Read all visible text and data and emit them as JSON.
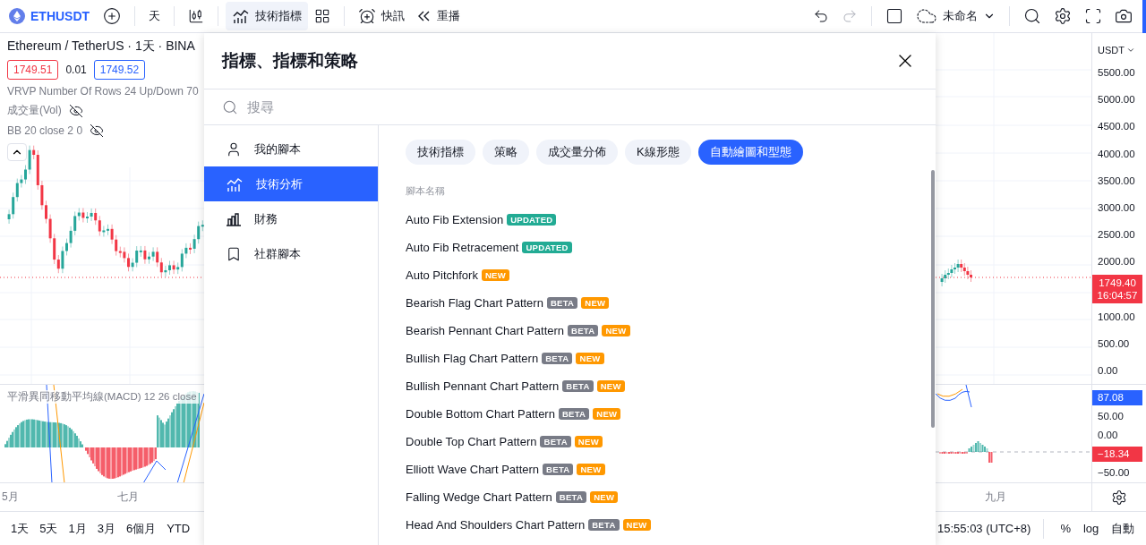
{
  "toolbar": {
    "symbol": "ETHUSDT",
    "interval": "天",
    "indicators_button": {
      "label": "技術指標",
      "selected": true
    },
    "alerts": "快訊",
    "replay": "重播",
    "layout_name": "未命名",
    "redo_disabled": true
  },
  "legend": {
    "title": "Ethereum / TetherUS · 1天 · BINA",
    "bid": "1749.51",
    "spread": "0.01",
    "ask": "1749.52",
    "indicators": [
      {
        "label": "VRVP Number Of Rows 24 Up/Down 70",
        "hidden": false
      },
      {
        "label": "成交量(Vol)",
        "hidden": true
      },
      {
        "label": "BB 20 close 2 0",
        "hidden": true
      }
    ],
    "macd": "平滑異同移動平均線(MACD) 12 26 close"
  },
  "price_axis": {
    "currency": "USDT",
    "ticks_upper": [
      "5500.00",
      "5000.00",
      "4500.00",
      "4000.00",
      "3500.00",
      "3000.00",
      "2500.00",
      "2000.00"
    ],
    "ticks_lower": [
      "1000.00",
      "500.00",
      "0.00"
    ],
    "price_tag": {
      "price": "1749.40",
      "countdown": "16:04:57",
      "color": "#f23645"
    }
  },
  "macd_axis": {
    "tags": [
      {
        "value": "87.08",
        "color": "#2962ff"
      },
      {
        "value": "50.00"
      },
      {
        "value": "0.00"
      },
      {
        "value": "−18.34",
        "color": "#f23645"
      },
      {
        "value": "−50.00"
      }
    ]
  },
  "time_axis": {
    "left": [
      "5月",
      "七月"
    ],
    "right": [
      "九月"
    ]
  },
  "bottom_bar": {
    "ranges": [
      "1天",
      "5天",
      "1月",
      "3月",
      "6個月",
      "YTD"
    ],
    "clock": "15:55:03 (UTC+8)",
    "percent": "%",
    "log": "log",
    "auto": "自動"
  },
  "dialog": {
    "title": "指標、指標和策略",
    "search_placeholder": "搜尋",
    "nav": [
      {
        "label": "我的腳本",
        "kind": "person",
        "selected": false
      },
      {
        "label": "技術分析",
        "kind": "analysis",
        "selected": true
      },
      {
        "label": "財務",
        "kind": "finance",
        "selected": false
      },
      {
        "label": "社群腳本",
        "kind": "bookmark",
        "selected": false
      }
    ],
    "chips": [
      {
        "label": "技術指標",
        "selected": false
      },
      {
        "label": "策略",
        "selected": false
      },
      {
        "label": "成交量分佈",
        "selected": false
      },
      {
        "label": "K線形態",
        "selected": false
      },
      {
        "label": "自動繪圖和型態",
        "selected": true
      }
    ],
    "list_header": "腳本名稱",
    "scripts": [
      {
        "name": "Auto Fib Extension",
        "badges": [
          {
            "kind": "updated",
            "label": "UPDATED"
          }
        ]
      },
      {
        "name": "Auto Fib Retracement",
        "badges": [
          {
            "kind": "updated",
            "label": "UPDATED"
          }
        ]
      },
      {
        "name": "Auto Pitchfork",
        "badges": [
          {
            "kind": "new",
            "label": "NEW"
          }
        ]
      },
      {
        "name": "Bearish Flag Chart Pattern",
        "badges": [
          {
            "kind": "beta",
            "label": "BETA"
          },
          {
            "kind": "new",
            "label": "NEW"
          }
        ]
      },
      {
        "name": "Bearish Pennant Chart Pattern",
        "badges": [
          {
            "kind": "beta",
            "label": "BETA"
          },
          {
            "kind": "new",
            "label": "NEW"
          }
        ]
      },
      {
        "name": "Bullish Flag Chart Pattern",
        "badges": [
          {
            "kind": "beta",
            "label": "BETA"
          },
          {
            "kind": "new",
            "label": "NEW"
          }
        ]
      },
      {
        "name": "Bullish Pennant Chart Pattern",
        "badges": [
          {
            "kind": "beta",
            "label": "BETA"
          },
          {
            "kind": "new",
            "label": "NEW"
          }
        ]
      },
      {
        "name": "Double Bottom Chart Pattern",
        "badges": [
          {
            "kind": "beta",
            "label": "BETA"
          },
          {
            "kind": "new",
            "label": "NEW"
          }
        ]
      },
      {
        "name": "Double Top Chart Pattern",
        "badges": [
          {
            "kind": "beta",
            "label": "BETA"
          },
          {
            "kind": "new",
            "label": "NEW"
          }
        ]
      },
      {
        "name": "Elliott Wave Chart Pattern",
        "badges": [
          {
            "kind": "beta",
            "label": "BETA"
          },
          {
            "kind": "new",
            "label": "NEW"
          }
        ]
      },
      {
        "name": "Falling Wedge Chart Pattern",
        "badges": [
          {
            "kind": "beta",
            "label": "BETA"
          },
          {
            "kind": "new",
            "label": "NEW"
          }
        ]
      },
      {
        "name": "Head And Shoulders Chart Pattern",
        "badges": [
          {
            "kind": "beta",
            "label": "BETA"
          },
          {
            "kind": "new",
            "label": "NEW"
          }
        ]
      }
    ]
  }
}
